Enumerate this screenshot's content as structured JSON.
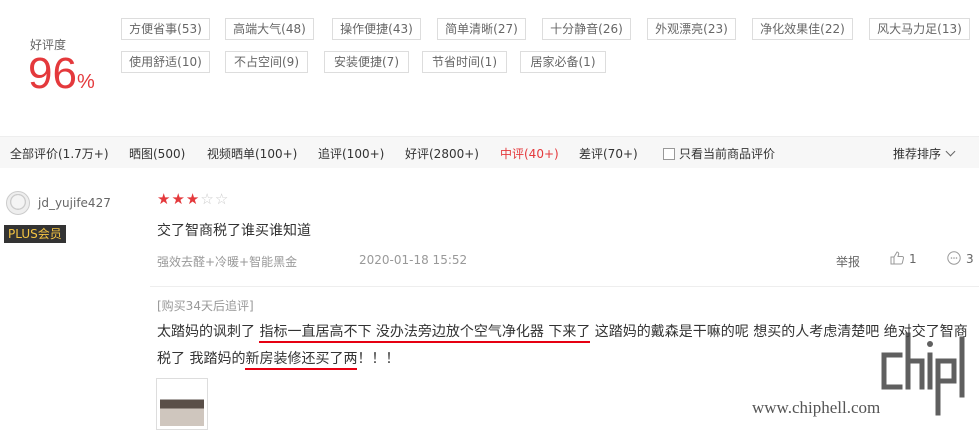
{
  "rating": {
    "label": "好评度",
    "value": "96",
    "unit": "%"
  },
  "tags": [
    "方便省事(53)",
    "高端大气(48)",
    "操作便捷(43)",
    "简单清晰(27)",
    "十分静音(26)",
    "外观漂亮(23)",
    "净化效果佳(22)",
    "风大马力足(13)",
    "使用舒适(10)",
    "不占空间(9)",
    "安装便捷(7)",
    "节省时间(1)",
    "居家必备(1)"
  ],
  "filters": {
    "tabs": [
      {
        "label": "全部评价(1.7万+)"
      },
      {
        "label": "晒图(500)"
      },
      {
        "label": "视频晒单(100+)"
      },
      {
        "label": "追评(100+)"
      },
      {
        "label": "好评(2800+)"
      },
      {
        "label": "中评(40+)"
      },
      {
        "label": "差评(70+)"
      }
    ],
    "active_tab": "中评(40+)",
    "only_current": "只看当前商品评价",
    "sort": "推荐排序"
  },
  "review": {
    "username": "jd_yujife427",
    "badge": "PLUS会员",
    "stars": {
      "filled": 3,
      "total": 5
    },
    "text": "交了智商税了谁买谁知道",
    "product_meta": "强效去醛+冷暖+智能黑金",
    "date": "2020-01-18 15:52",
    "report": "举报",
    "likes": "1",
    "replies": "3",
    "append_label": "[购买34天后追评]",
    "append_segments": [
      {
        "text": "太踏妈的讽刺了 ",
        "underline": false
      },
      {
        "text": "指标一直居高不下 没办法旁边放个空气净化器 下来了",
        "underline": true
      },
      {
        "text": " 这踏妈的戴森是干嘛的呢 想买的人考虑清楚吧 绝对交了智商税了 我踏妈的",
        "underline": false
      },
      {
        "text": "新房装修还买了两",
        "underline": true
      },
      {
        "text": "！！！",
        "underline": false
      }
    ]
  },
  "watermark": {
    "url": "www.chiphell.com"
  },
  "colors": {
    "accent": "#e4393c",
    "underline": "#e60012",
    "badge_bg": "#333333",
    "badge_fg": "#f5c542"
  }
}
